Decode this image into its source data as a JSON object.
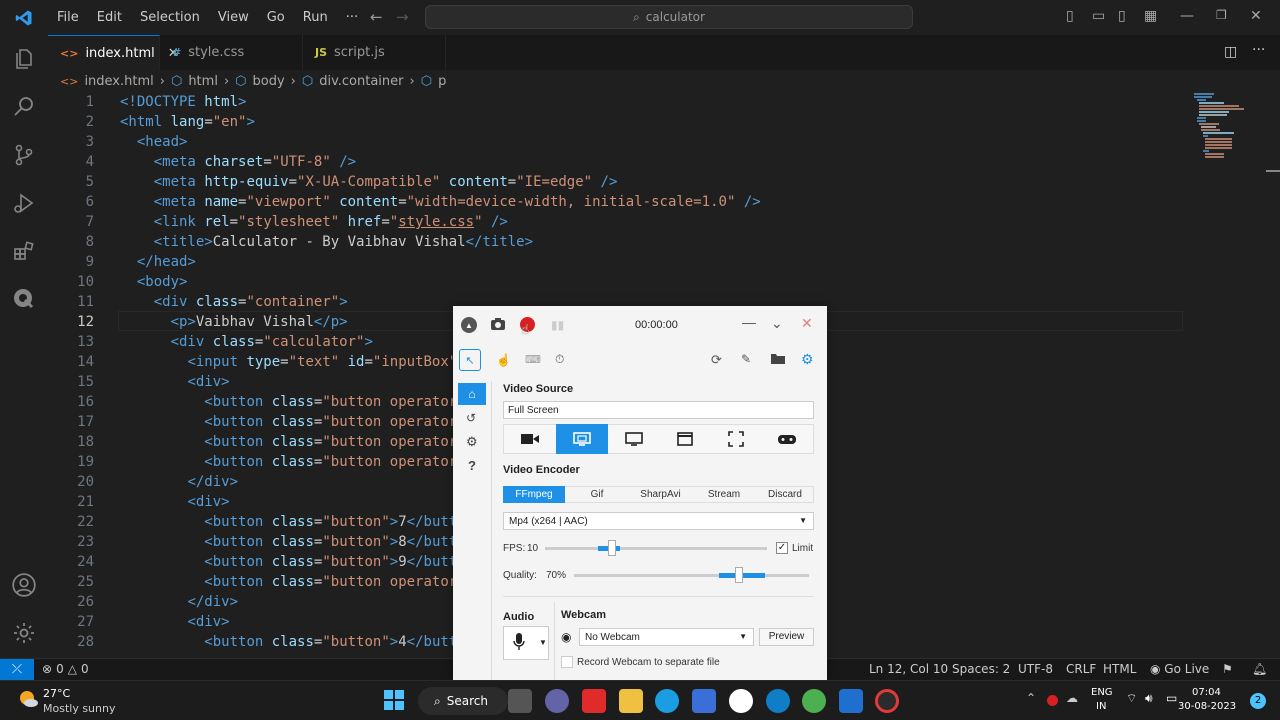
{
  "menu": [
    "File",
    "Edit",
    "Selection",
    "View",
    "Go",
    "Run",
    "···"
  ],
  "command_center": {
    "text": "calculator"
  },
  "tabs": [
    {
      "label": "index.html",
      "icon": "html-icon",
      "active": true
    },
    {
      "label": "style.css",
      "icon": "css-icon",
      "active": false
    },
    {
      "label": "script.js",
      "icon": "js-icon",
      "active": false
    }
  ],
  "breadcrumb": [
    "index.html",
    "html",
    "body",
    "div.container",
    "p"
  ],
  "code_lines": [
    {
      "n": "1",
      "html": "<span class=t>&lt;!DOCTYPE</span> <span class=a>html</span><span class=t>&gt;</span>"
    },
    {
      "n": "2",
      "html": "<span class=t>&lt;html</span> <span class=a>lang</span>=<span class=s>\"en\"</span><span class=t>&gt;</span>"
    },
    {
      "n": "3",
      "html": "  <span class=t>&lt;head&gt;</span>"
    },
    {
      "n": "4",
      "html": "    <span class=t>&lt;meta</span> <span class=a>charset</span>=<span class=s>\"UTF-8\"</span> <span class=t>/&gt;</span>"
    },
    {
      "n": "5",
      "html": "    <span class=t>&lt;meta</span> <span class=a>http-equiv</span>=<span class=s>\"X-UA-Compatible\"</span> <span class=a>content</span>=<span class=s>\"IE=edge\"</span> <span class=t>/&gt;</span>"
    },
    {
      "n": "6",
      "html": "    <span class=t>&lt;meta</span> <span class=a>name</span>=<span class=s>\"viewport\"</span> <span class=a>content</span>=<span class=s>\"width=device-width, initial-scale=1.0\"</span> <span class=t>/&gt;</span>"
    },
    {
      "n": "7",
      "html": "    <span class=t>&lt;link</span> <span class=a>rel</span>=<span class=s>\"stylesheet\"</span> <span class=a>href</span>=<span class=s>\"<u>style.css</u>\"</span> <span class=t>/&gt;</span>"
    },
    {
      "n": "8",
      "html": "    <span class=t>&lt;title&gt;</span>Calculator - By Vaibhav Vishal<span class=t>&lt;/title&gt;</span>"
    },
    {
      "n": "9",
      "html": "  <span class=t>&lt;/head&gt;</span>"
    },
    {
      "n": "10",
      "html": "  <span class=t>&lt;body&gt;</span>"
    },
    {
      "n": "11",
      "html": "    <span class=t>&lt;div</span> <span class=a>class</span>=<span class=s>\"container\"</span><span class=t>&gt;</span>"
    },
    {
      "n": "12",
      "html": "      <span class=t>&lt;p&gt;</span>Vaibhav Vishal<span class=t>&lt;/p&gt;</span>"
    },
    {
      "n": "13",
      "html": "      <span class=t>&lt;div</span> <span class=a>class</span>=<span class=s>\"calculator\"</span><span class=t>&gt;</span>"
    },
    {
      "n": "14",
      "html": "        <span class=t>&lt;input</span> <span class=a>type</span>=<span class=s>\"text\"</span> <span class=a>id</span>=<span class=s>\"inputBox\"</span>"
    },
    {
      "n": "15",
      "html": "        <span class=t>&lt;div&gt;</span>"
    },
    {
      "n": "16",
      "html": "          <span class=t>&lt;button</span> <span class=a>class</span>=<span class=s>\"button operator\"</span>"
    },
    {
      "n": "17",
      "html": "          <span class=t>&lt;button</span> <span class=a>class</span>=<span class=s>\"button operator\"</span>"
    },
    {
      "n": "18",
      "html": "          <span class=t>&lt;button</span> <span class=a>class</span>=<span class=s>\"button operator\"</span>"
    },
    {
      "n": "19",
      "html": "          <span class=t>&lt;button</span> <span class=a>class</span>=<span class=s>\"button operator\"</span>"
    },
    {
      "n": "20",
      "html": "        <span class=t>&lt;/div&gt;</span>"
    },
    {
      "n": "21",
      "html": "        <span class=t>&lt;div&gt;</span>"
    },
    {
      "n": "22",
      "html": "          <span class=t>&lt;button</span> <span class=a>class</span>=<span class=s>\"button\"</span><span class=t>&gt;</span>7<span class=t>&lt;/butto</span>"
    },
    {
      "n": "23",
      "html": "          <span class=t>&lt;button</span> <span class=a>class</span>=<span class=s>\"button\"</span><span class=t>&gt;</span>8<span class=t>&lt;/butto</span>"
    },
    {
      "n": "24",
      "html": "          <span class=t>&lt;button</span> <span class=a>class</span>=<span class=s>\"button\"</span><span class=t>&gt;</span>9<span class=t>&lt;/butto</span>"
    },
    {
      "n": "25",
      "html": "          <span class=t>&lt;button</span> <span class=a>class</span>=<span class=s>\"button operator\"</span>"
    },
    {
      "n": "26",
      "html": "        <span class=t>&lt;/div&gt;</span>"
    },
    {
      "n": "27",
      "html": "        <span class=t>&lt;div&gt;</span>"
    },
    {
      "n": "28",
      "html": "          <span class=t>&lt;button</span> <span class=a>class</span>=<span class=s>\"button\"</span><span class=t>&gt;</span>4<span class=t>&lt;/butto</span>"
    }
  ],
  "status": {
    "errors": "0",
    "warnings": "0",
    "position": "Ln 12, Col 10",
    "spaces": "Spaces: 2",
    "encoding": "UTF-8",
    "eol": "CRLF",
    "language": "HTML",
    "golive": "Go Live"
  },
  "recorder": {
    "timer": "00:00:00",
    "video_source_label": "Video Source",
    "video_source_value": "Full Screen",
    "video_encoder_label": "Video Encoder",
    "encoder_tabs": [
      "FFmpeg",
      "Gif",
      "SharpAvi",
      "Stream",
      "Discard"
    ],
    "format": "Mp4 (x264 | AAC)",
    "fps_label": "FPS:",
    "fps_value": "10",
    "fps_level": 0.3,
    "limit_label": "Limit",
    "quality_label": "Quality:",
    "quality_value": "70%",
    "quality_level": 0.7,
    "audio_label": "Audio",
    "webcam_label": "Webcam",
    "webcam_value": "No Webcam",
    "preview_label": "Preview",
    "webcam_separate": "Record Webcam to separate file"
  },
  "weather": {
    "temp": "27°C",
    "desc": "Mostly sunny"
  },
  "taskbar": {
    "search": "Search"
  },
  "tray": {
    "lang1": "ENG",
    "lang2": "IN",
    "time": "07:04",
    "date": "30-08-2023",
    "notif": "2"
  },
  "colors": {
    "accent": "#0078d4",
    "tag": "#569cd6",
    "attr": "#9cdcfe",
    "string": "#ce9178",
    "rec_blue": "#1e90e6",
    "record_red": "#d92020"
  }
}
